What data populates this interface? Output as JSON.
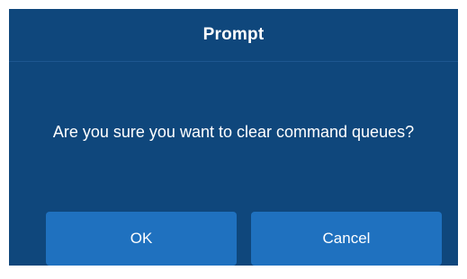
{
  "dialog": {
    "title": "Prompt",
    "message": "Are you sure you want to clear command queues?",
    "buttons": {
      "ok_label": "OK",
      "cancel_label": "Cancel"
    }
  },
  "colors": {
    "dialog_background": "#0f477c",
    "button_background": "#1f71bf",
    "text": "#ffffff"
  }
}
